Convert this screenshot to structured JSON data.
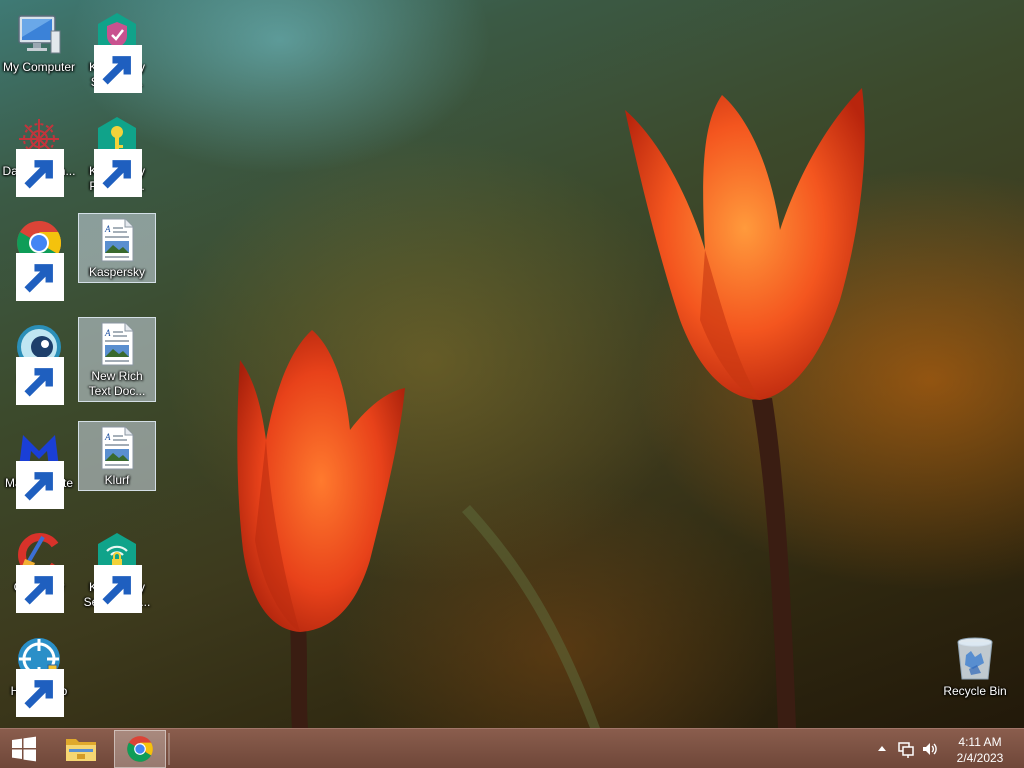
{
  "desktop": {
    "icons": [
      {
        "id": "my-computer",
        "label": "My Computer"
      },
      {
        "id": "kaspersky-security",
        "label": "Kaspersky Security..."
      },
      {
        "id": "datawagon",
        "label": "DataWagon..."
      },
      {
        "id": "kaspersky-password",
        "label": "Kaspersky Passwor..."
      },
      {
        "id": "google-chrome",
        "label": "Google Chrome"
      },
      {
        "id": "kaspersky-doc",
        "label": "Kaspersky"
      },
      {
        "id": "glaz-tv",
        "label": "Глаз.ТВ"
      },
      {
        "id": "new-rich-text",
        "label": "New Rich Text Doc..."
      },
      {
        "id": "malwarebytes",
        "label": "Malwarebytes"
      },
      {
        "id": "klurf",
        "label": "Klurf"
      },
      {
        "id": "ccleaner",
        "label": "CCleaner"
      },
      {
        "id": "kaspersky-secure-connection",
        "label": "Kaspersky Secure Co..."
      },
      {
        "id": "hitmanpro",
        "label": "HitmanPro"
      },
      {
        "id": "recycle-bin",
        "label": "Recycle Bin"
      }
    ]
  },
  "taskbar": {
    "pinned": [
      {
        "name": "start-button",
        "icon": "windows-logo-icon"
      },
      {
        "name": "file-explorer-button",
        "icon": "folder-icon"
      },
      {
        "name": "chrome-taskbar-button",
        "icon": "chrome-icon",
        "active": true
      }
    ],
    "tray": {
      "icons": [
        "show-hidden-icons-arrow",
        "network-icon",
        "volume-icon"
      ]
    },
    "clock": {
      "time": "4:11 AM",
      "date": "2/4/2023"
    }
  },
  "colors": {
    "taskbar": "#7b5142",
    "selection": "#cddae8",
    "chrome_red": "#db4437",
    "chrome_yellow": "#f4c20d",
    "chrome_green": "#0f9d58",
    "chrome_blue": "#4285f4",
    "kaspersky_green": "#0fa68a",
    "tulip_orange": "#ff5a1f"
  }
}
